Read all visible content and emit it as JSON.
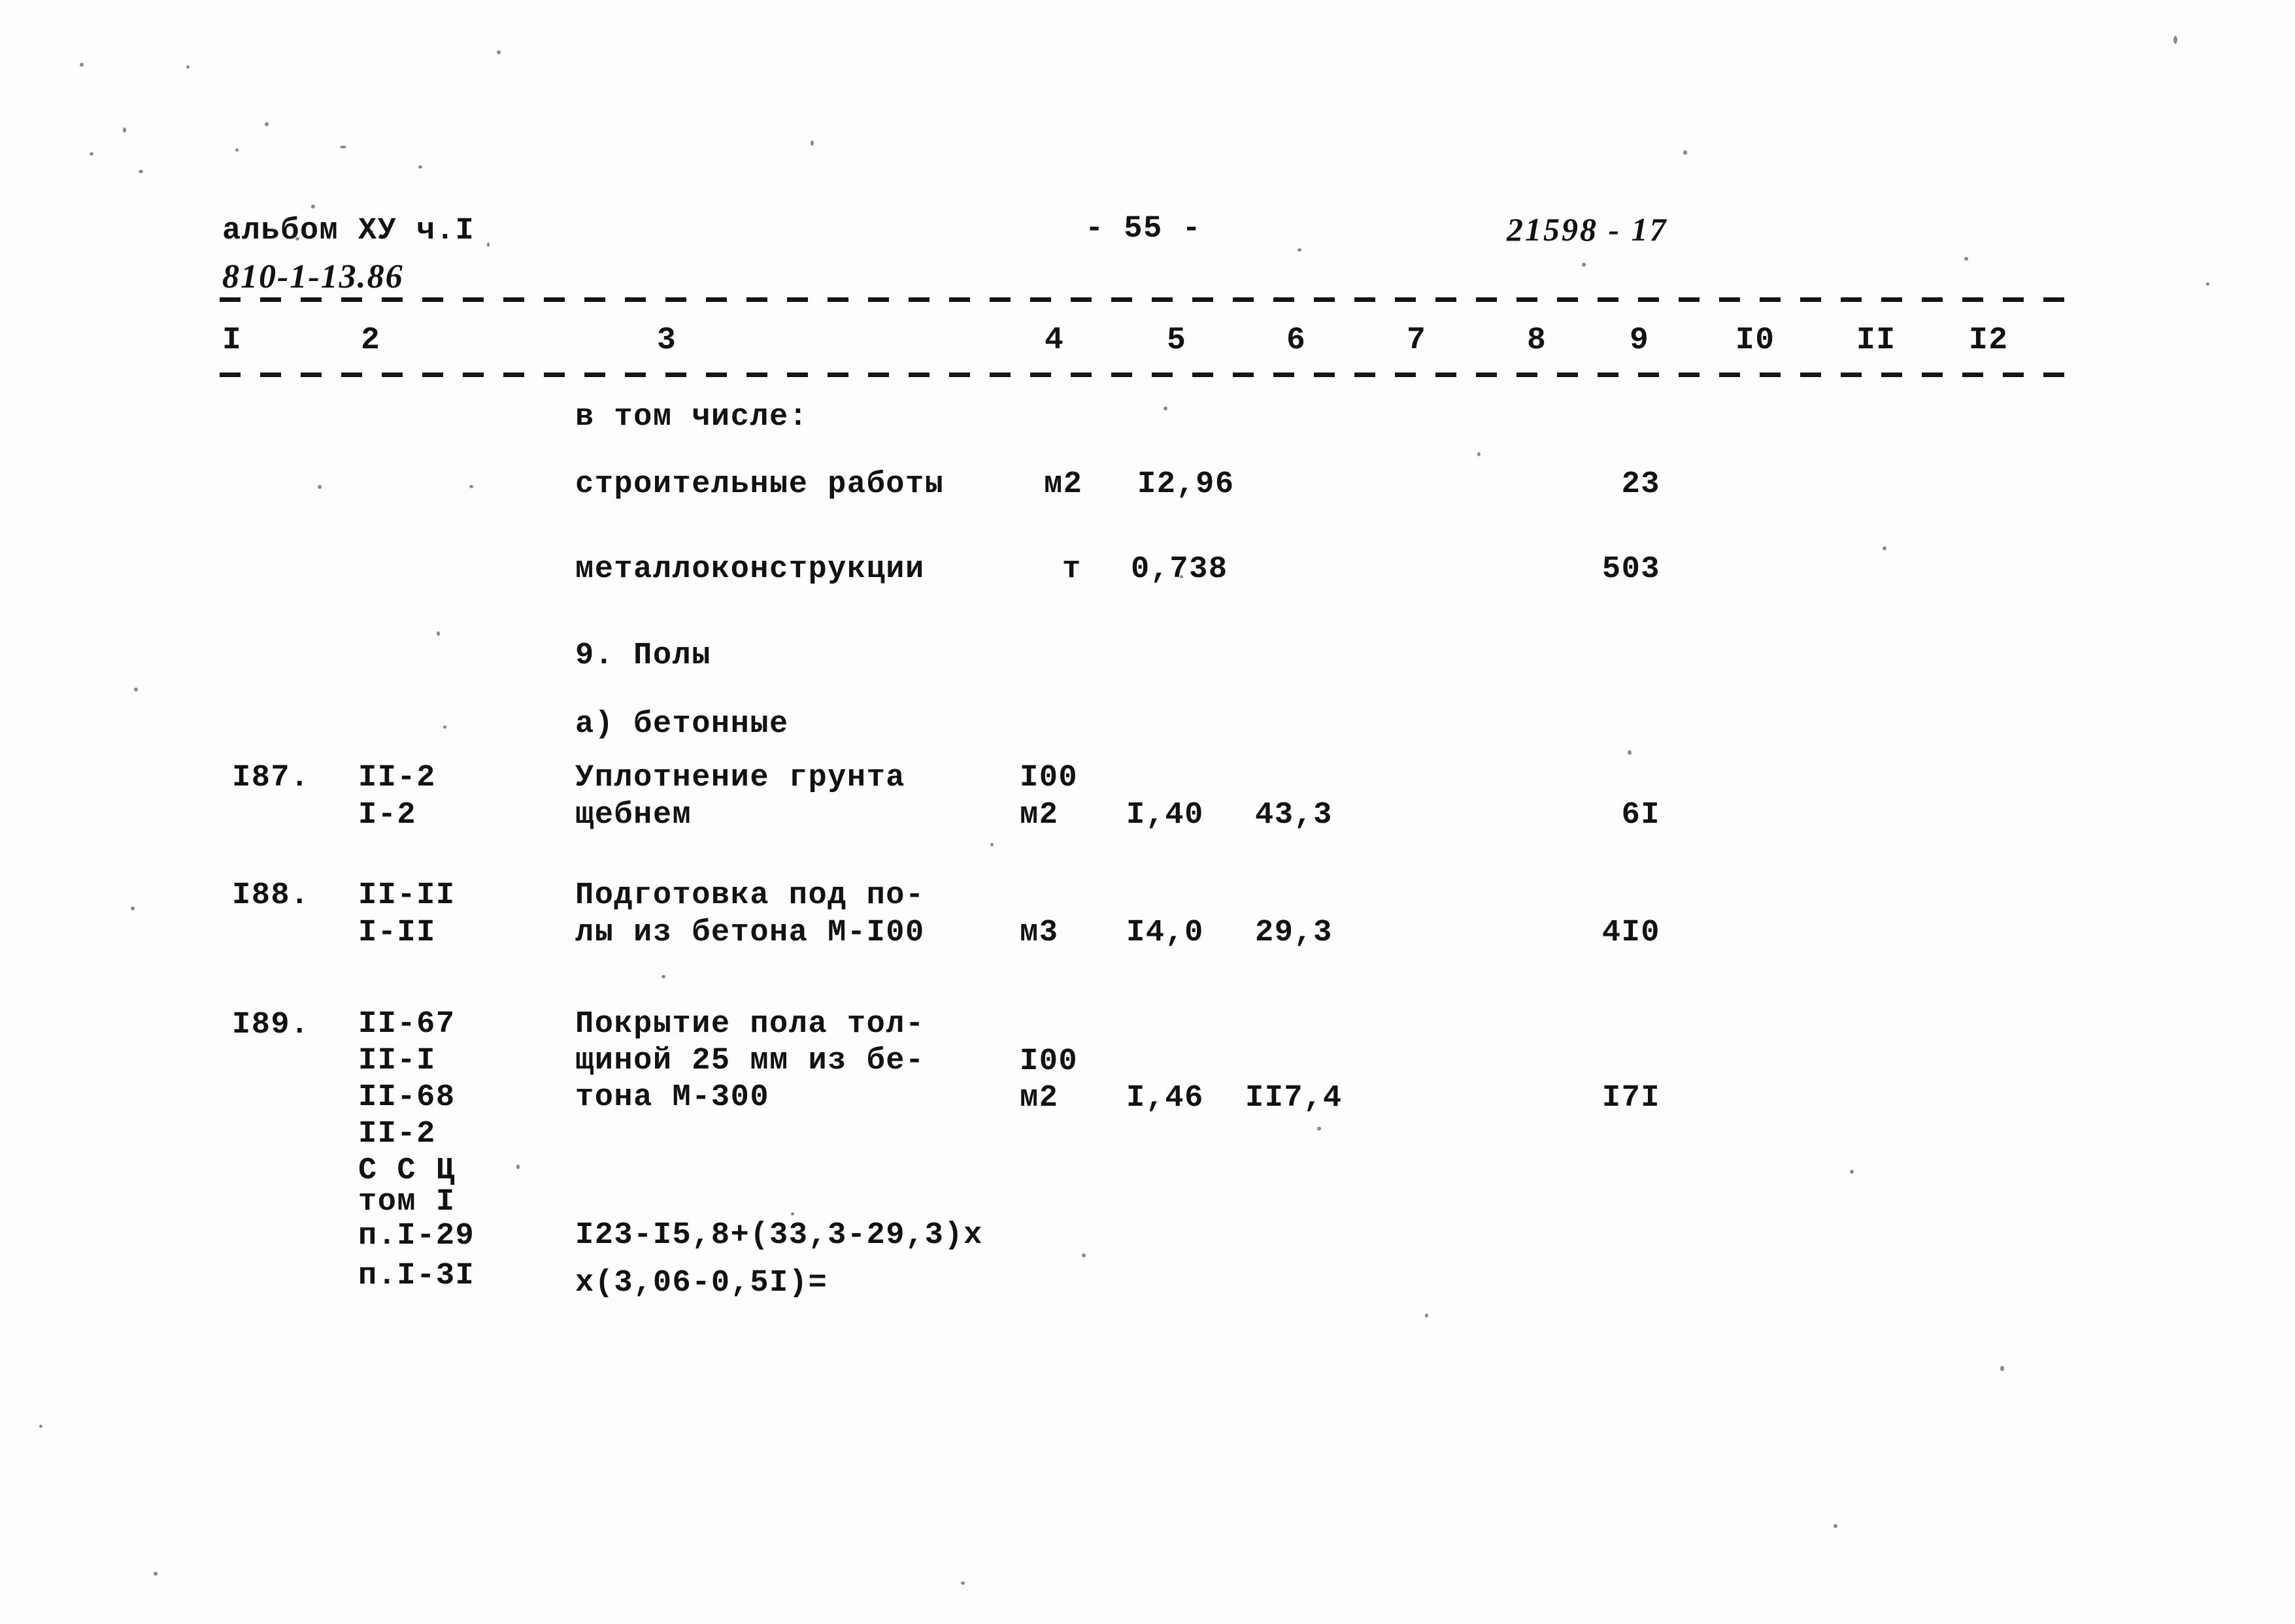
{
  "document": {
    "album_label": "альбом ХУ ч.I",
    "project_code": "810-1-13.86",
    "page_number": "- 55 -",
    "archive_stamp": "21598 - 17"
  },
  "table": {
    "column_headers": [
      "I",
      "2",
      "3",
      "4",
      "5",
      "6",
      "7",
      "8",
      "9",
      "I0",
      "II",
      "I2"
    ],
    "subtotal_block": {
      "label": "в том числе:",
      "rows": [
        {
          "name": "строительные работы",
          "unit": "м2",
          "qty": "I2,96",
          "total": "23"
        },
        {
          "name": "металлоконструкции",
          "unit": "т",
          "qty": "0,738",
          "total": "503"
        }
      ]
    },
    "section_heading": "9. Полы",
    "subsection_heading": "а) бетонные",
    "rows": [
      {
        "no": "I87.",
        "codes": [
          "II-2",
          "I-2"
        ],
        "description": [
          "Уплотнение грунта",
          "щебнем"
        ],
        "unit_top": "I00",
        "unit": "м2",
        "qty": "I,40",
        "rate": "43,3",
        "total": "6I"
      },
      {
        "no": "I88.",
        "codes": [
          "II-II",
          "I-II"
        ],
        "description": [
          "Подготовка под по-",
          "лы из бетона М-I00"
        ],
        "unit_top": "",
        "unit": "м3",
        "qty": "I4,0",
        "rate": "29,3",
        "total": "4I0"
      },
      {
        "no": "I89.",
        "codes": [
          "II-67",
          "II-I",
          "II-68",
          "II-2",
          "С С Ц",
          "том I",
          "п.I-29",
          "п.I-3I"
        ],
        "description": [
          "Покрытие пола тол-",
          "щиной 25 мм из бе-",
          "тона М-300"
        ],
        "unit_top": "I00",
        "unit": "м2",
        "qty": "I,46",
        "rate": "II7,4",
        "total": "I7I",
        "formula": [
          "I23-I5,8+(33,3-29,3)х",
          "х(3,06-0,5I)="
        ]
      }
    ]
  }
}
